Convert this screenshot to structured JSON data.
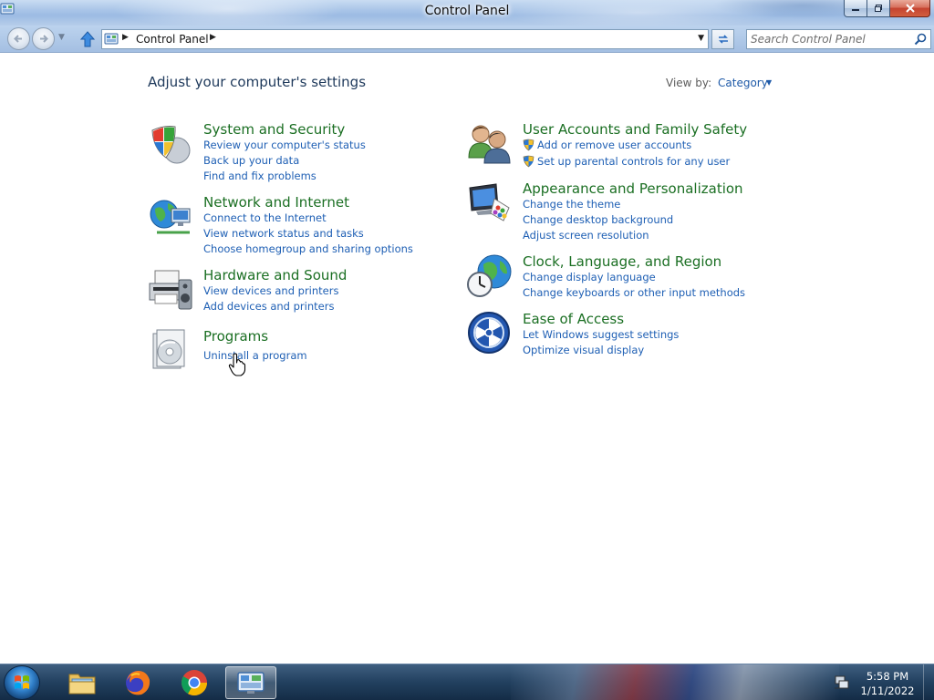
{
  "window": {
    "title": "Control Panel",
    "controls": [
      "minimize",
      "maximize",
      "close"
    ]
  },
  "navigation": {
    "breadcrumb": [
      "Control Panel"
    ],
    "search_placeholder": "Search Control Panel"
  },
  "main": {
    "heading": "Adjust your computer's settings",
    "view_by_label": "View by:",
    "view_by_value": "Category",
    "categories": [
      {
        "title": "System and Security",
        "icon": "shield-icon",
        "links": [
          "Review your computer's status",
          "Back up your data",
          "Find and fix problems"
        ]
      },
      {
        "title": "Network and Internet",
        "icon": "network-globe-icon",
        "links": [
          "Connect to the Internet",
          "View network status and tasks",
          "Choose homegroup and sharing options"
        ]
      },
      {
        "title": "Hardware and Sound",
        "icon": "printer-speaker-icon",
        "links": [
          "View devices and printers",
          "Add devices and printers"
        ]
      },
      {
        "title": "Programs",
        "icon": "programs-disc-icon",
        "links": [
          "Uninstall a program"
        ]
      },
      {
        "title": "User Accounts and Family Safety",
        "icon": "users-icon",
        "links": [
          "Add or remove user accounts",
          "Set up parental controls for any user"
        ]
      },
      {
        "title": "Appearance and Personalization",
        "icon": "monitor-palette-icon",
        "links": [
          "Change the theme",
          "Change desktop background",
          "Adjust screen resolution"
        ]
      },
      {
        "title": "Clock, Language, and Region",
        "icon": "clock-globe-icon",
        "links": [
          "Change display language",
          "Change keyboards or other input methods"
        ]
      },
      {
        "title": "Ease of Access",
        "icon": "ease-of-access-icon",
        "links": [
          "Let Windows suggest settings",
          "Optimize visual display"
        ]
      }
    ]
  },
  "taskbar": {
    "items": [
      "windows-explorer-icon",
      "firefox-icon",
      "chrome-icon",
      "control-panel-icon"
    ],
    "active_item": "control-panel-icon",
    "clock_time": "5:58 PM",
    "clock_date": "1/11/2022"
  },
  "colors": {
    "category_title": "#1b6f23",
    "link": "#1e5fb4",
    "heading": "#1e395b"
  }
}
